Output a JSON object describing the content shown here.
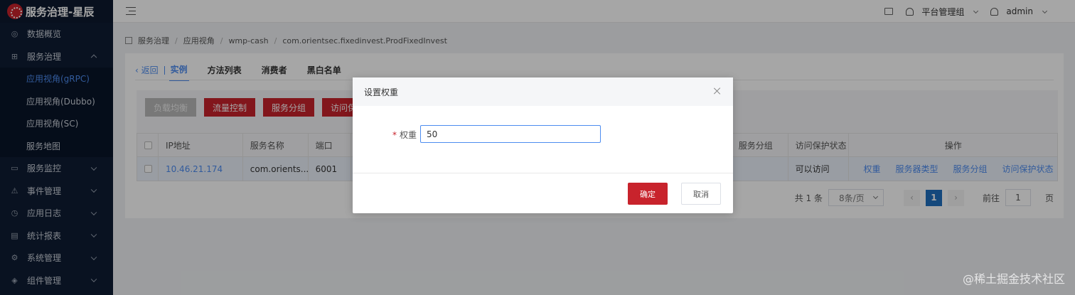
{
  "app": {
    "title": "服务治理-星辰"
  },
  "sidebar": {
    "items": [
      {
        "label": "数据概览",
        "icon": "dashboard-icon"
      },
      {
        "label": "服务治理",
        "icon": "grid-icon",
        "expanded": true
      },
      {
        "label": "服务监控",
        "icon": "monitor-icon"
      },
      {
        "label": "事件管理",
        "icon": "warning-icon"
      },
      {
        "label": "应用日志",
        "icon": "log-icon"
      },
      {
        "label": "统计报表",
        "icon": "chart-icon"
      },
      {
        "label": "系统管理",
        "icon": "gear-icon"
      },
      {
        "label": "组件管理",
        "icon": "component-icon"
      }
    ],
    "subitems": [
      {
        "label": "应用视角(gRPC)",
        "active": true
      },
      {
        "label": "应用视角(Dubbo)"
      },
      {
        "label": "应用视角(SC)"
      },
      {
        "label": "服务地图"
      }
    ]
  },
  "header": {
    "group": "平台管理组",
    "user": "admin"
  },
  "breadcrumb": [
    "服务治理",
    "应用视角",
    "wmp-cash",
    "com.orientsec.fixedinvest.ProdFixedInvest"
  ],
  "tabs": {
    "back": "返回",
    "items": [
      "实例",
      "方法列表",
      "消费者",
      "黑白名单"
    ]
  },
  "toolbar": {
    "buttons": [
      "负载均衡",
      "流量控制",
      "服务分组",
      "访问保"
    ]
  },
  "table": {
    "headers": [
      "IP地址",
      "服务名称",
      "端口",
      "服务分组",
      "访问保护状态",
      "操作"
    ],
    "row": {
      "ip": "10.46.21.174",
      "service": "com.orients...",
      "port": "6001",
      "group": "",
      "status": "可以访问",
      "actions": [
        "权重",
        "服务器类型",
        "服务分组",
        "访问保护状态"
      ]
    }
  },
  "pagination": {
    "total": "共 1 条",
    "page_size": "8条/页",
    "current": "1",
    "goto_label": "前往",
    "goto_value": "1",
    "page_suffix": "页"
  },
  "modal": {
    "title": "设置权重",
    "label": "权重",
    "required_mark": "*",
    "value": "50",
    "ok": "确定",
    "cancel": "取消"
  },
  "watermark": "@稀土掘金技术社区",
  "colors": {
    "primary": "#c8232c",
    "link": "#4d8cf0",
    "sidebar": "#0f1d33"
  }
}
